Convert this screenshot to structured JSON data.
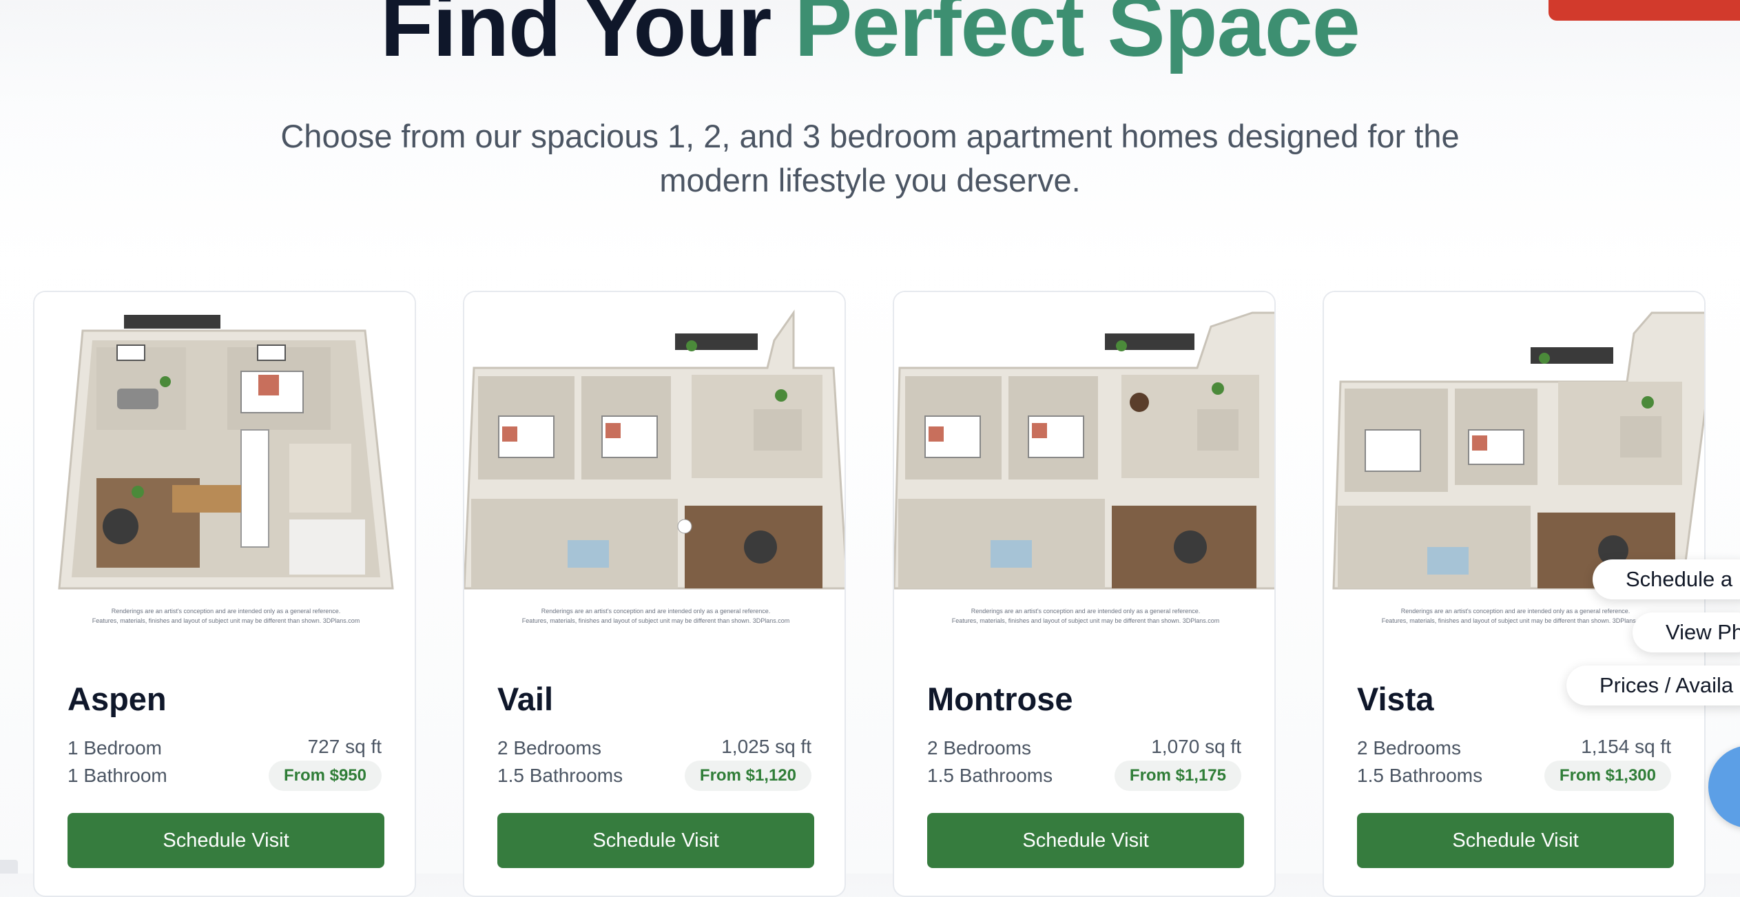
{
  "hero": {
    "title_main": "Find Your ",
    "title_accent": "Perfect Space",
    "subtitle": "Choose from our spacious 1, 2, and 3 bedroom apartment homes designed for the modern lifestyle you deserve."
  },
  "disclaimer": {
    "line1": "Renderings are an artist's conception and are intended only as a general reference.",
    "line2": "Features, materials, finishes and layout of subject unit may be different than shown. 3DPlans.com"
  },
  "floorplans": [
    {
      "name": "Aspen",
      "bedrooms": "1 Bedroom",
      "bathrooms": "1 Bathroom",
      "sqft": "727 sq ft",
      "price": "From $950",
      "button": "Schedule Visit"
    },
    {
      "name": "Vail",
      "bedrooms": "2 Bedrooms",
      "bathrooms": "1.5 Bathrooms",
      "sqft": "1,025 sq ft",
      "price": "From $1,120",
      "button": "Schedule Visit"
    },
    {
      "name": "Montrose",
      "bedrooms": "2 Bedrooms",
      "bathrooms": "1.5 Bathrooms",
      "sqft": "1,070 sq ft",
      "price": "From $1,175",
      "button": "Schedule Visit"
    },
    {
      "name": "Vista",
      "bedrooms": "2 Bedrooms",
      "bathrooms": "1.5 Bathrooms",
      "sqft": "1,154 sq ft",
      "price": "From $1,300",
      "button": "Schedule Visit"
    }
  ],
  "floating_actions": [
    "Schedule a",
    "View Ph",
    "Prices / Availa"
  ],
  "colors": {
    "accent_green": "#3d8f71",
    "button_green": "#367c3e",
    "price_text": "#2f7d37",
    "badge_red": "#d23a2c",
    "chat_blue": "#5c9fe6"
  },
  "icons": {
    "chat_button": "chat-icon"
  }
}
